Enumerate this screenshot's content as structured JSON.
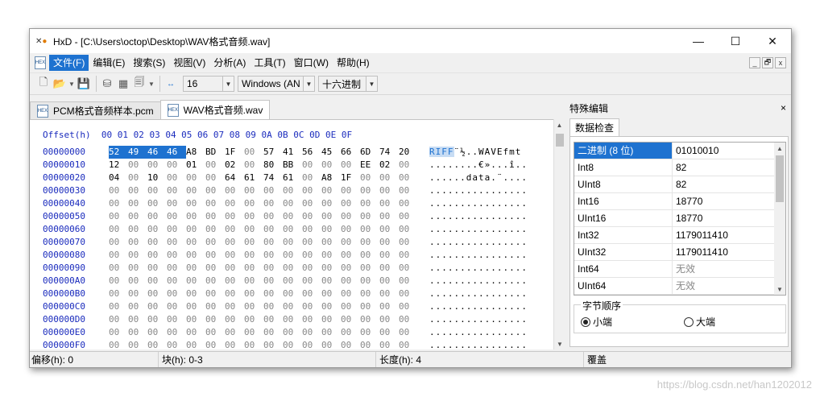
{
  "window": {
    "title": "HxD - [C:\\Users\\octop\\Desktop\\WAV格式音频.wav]",
    "minimize": "—",
    "maximize": "☐",
    "close": "✕"
  },
  "menu": {
    "items": [
      "文件(F)",
      "编辑(E)",
      "搜索(S)",
      "视图(V)",
      "分析(A)",
      "工具(T)",
      "窗口(W)",
      "帮助(H)"
    ],
    "mdi": [
      "_",
      "🗗",
      "x"
    ]
  },
  "toolbar": {
    "bytes_per_row": "16",
    "charset": "Windows (AN",
    "offset_base": "十六进制"
  },
  "tabs": [
    {
      "label": "PCM格式音频样本.pcm",
      "active": false
    },
    {
      "label": "WAV格式音频.wav",
      "active": true
    }
  ],
  "hex": {
    "header": "Offset(h)  00 01 02 03 04 05 06 07 08 09 0A 0B 0C 0D 0E 0F",
    "rows": [
      {
        "offset": "00000000",
        "bytes": [
          "52",
          "49",
          "46",
          "46",
          "A8",
          "BD",
          "1F",
          "00",
          "57",
          "41",
          "56",
          "45",
          "66",
          "6D",
          "74",
          "20"
        ],
        "ascii_sel": "RIFF",
        "ascii": "¨½..WAVEfmt "
      },
      {
        "offset": "00000010",
        "bytes": [
          "12",
          "00",
          "00",
          "00",
          "01",
          "00",
          "02",
          "00",
          "80",
          "BB",
          "00",
          "00",
          "00",
          "EE",
          "02",
          "00"
        ],
        "ascii_sel": "",
        "ascii": "........€»...î.."
      },
      {
        "offset": "00000020",
        "bytes": [
          "04",
          "00",
          "10",
          "00",
          "00",
          "00",
          "64",
          "61",
          "74",
          "61",
          "00",
          "A8",
          "1F",
          "00",
          "00",
          "00"
        ],
        "ascii_sel": "",
        "ascii": "......data.¨...."
      },
      {
        "offset": "00000030",
        "bytes": [
          "00",
          "00",
          "00",
          "00",
          "00",
          "00",
          "00",
          "00",
          "00",
          "00",
          "00",
          "00",
          "00",
          "00",
          "00",
          "00"
        ],
        "ascii_sel": "",
        "ascii": "................"
      },
      {
        "offset": "00000040",
        "bytes": [
          "00",
          "00",
          "00",
          "00",
          "00",
          "00",
          "00",
          "00",
          "00",
          "00",
          "00",
          "00",
          "00",
          "00",
          "00",
          "00"
        ],
        "ascii_sel": "",
        "ascii": "................"
      },
      {
        "offset": "00000050",
        "bytes": [
          "00",
          "00",
          "00",
          "00",
          "00",
          "00",
          "00",
          "00",
          "00",
          "00",
          "00",
          "00",
          "00",
          "00",
          "00",
          "00"
        ],
        "ascii_sel": "",
        "ascii": "................"
      },
      {
        "offset": "00000060",
        "bytes": [
          "00",
          "00",
          "00",
          "00",
          "00",
          "00",
          "00",
          "00",
          "00",
          "00",
          "00",
          "00",
          "00",
          "00",
          "00",
          "00"
        ],
        "ascii_sel": "",
        "ascii": "................"
      },
      {
        "offset": "00000070",
        "bytes": [
          "00",
          "00",
          "00",
          "00",
          "00",
          "00",
          "00",
          "00",
          "00",
          "00",
          "00",
          "00",
          "00",
          "00",
          "00",
          "00"
        ],
        "ascii_sel": "",
        "ascii": "................"
      },
      {
        "offset": "00000080",
        "bytes": [
          "00",
          "00",
          "00",
          "00",
          "00",
          "00",
          "00",
          "00",
          "00",
          "00",
          "00",
          "00",
          "00",
          "00",
          "00",
          "00"
        ],
        "ascii_sel": "",
        "ascii": "................"
      },
      {
        "offset": "00000090",
        "bytes": [
          "00",
          "00",
          "00",
          "00",
          "00",
          "00",
          "00",
          "00",
          "00",
          "00",
          "00",
          "00",
          "00",
          "00",
          "00",
          "00"
        ],
        "ascii_sel": "",
        "ascii": "................"
      },
      {
        "offset": "000000A0",
        "bytes": [
          "00",
          "00",
          "00",
          "00",
          "00",
          "00",
          "00",
          "00",
          "00",
          "00",
          "00",
          "00",
          "00",
          "00",
          "00",
          "00"
        ],
        "ascii_sel": "",
        "ascii": "................"
      },
      {
        "offset": "000000B0",
        "bytes": [
          "00",
          "00",
          "00",
          "00",
          "00",
          "00",
          "00",
          "00",
          "00",
          "00",
          "00",
          "00",
          "00",
          "00",
          "00",
          "00"
        ],
        "ascii_sel": "",
        "ascii": "................"
      },
      {
        "offset": "000000C0",
        "bytes": [
          "00",
          "00",
          "00",
          "00",
          "00",
          "00",
          "00",
          "00",
          "00",
          "00",
          "00",
          "00",
          "00",
          "00",
          "00",
          "00"
        ],
        "ascii_sel": "",
        "ascii": "................"
      },
      {
        "offset": "000000D0",
        "bytes": [
          "00",
          "00",
          "00",
          "00",
          "00",
          "00",
          "00",
          "00",
          "00",
          "00",
          "00",
          "00",
          "00",
          "00",
          "00",
          "00"
        ],
        "ascii_sel": "",
        "ascii": "................"
      },
      {
        "offset": "000000E0",
        "bytes": [
          "00",
          "00",
          "00",
          "00",
          "00",
          "00",
          "00",
          "00",
          "00",
          "00",
          "00",
          "00",
          "00",
          "00",
          "00",
          "00"
        ],
        "ascii_sel": "",
        "ascii": "................"
      },
      {
        "offset": "000000F0",
        "bytes": [
          "00",
          "00",
          "00",
          "00",
          "00",
          "00",
          "00",
          "00",
          "00",
          "00",
          "00",
          "00",
          "00",
          "00",
          "00",
          "00"
        ],
        "ascii_sel": "",
        "ascii": "................"
      }
    ],
    "selected_count": 4
  },
  "side": {
    "title": "特殊编辑",
    "close": "×",
    "tab": "数据检查",
    "rows": [
      {
        "k": "二进制 (8 位)",
        "v": "01010010",
        "sel": true,
        "na": false
      },
      {
        "k": "Int8",
        "v": "82",
        "sel": false,
        "na": false
      },
      {
        "k": "UInt8",
        "v": "82",
        "sel": false,
        "na": false
      },
      {
        "k": "Int16",
        "v": "18770",
        "sel": false,
        "na": false
      },
      {
        "k": "UInt16",
        "v": "18770",
        "sel": false,
        "na": false
      },
      {
        "k": "Int32",
        "v": "1179011410",
        "sel": false,
        "na": false
      },
      {
        "k": "UInt32",
        "v": "1179011410",
        "sel": false,
        "na": false
      },
      {
        "k": "Int64",
        "v": "无效",
        "sel": false,
        "na": true
      },
      {
        "k": "UInt64",
        "v": "无效",
        "sel": false,
        "na": true
      }
    ],
    "byte_order": {
      "legend": "字节顺序",
      "little": "小端",
      "big": "大端",
      "selected": "little"
    }
  },
  "status": {
    "offset": "偏移(h): 0",
    "block": "块(h): 0-3",
    "length": "长度(h): 4",
    "mode": "覆盖"
  },
  "watermark": "https://blog.csdn.net/han1202012",
  "colors": {
    "selection": "#1e72d0",
    "offset_text": "#1a2bbd"
  }
}
